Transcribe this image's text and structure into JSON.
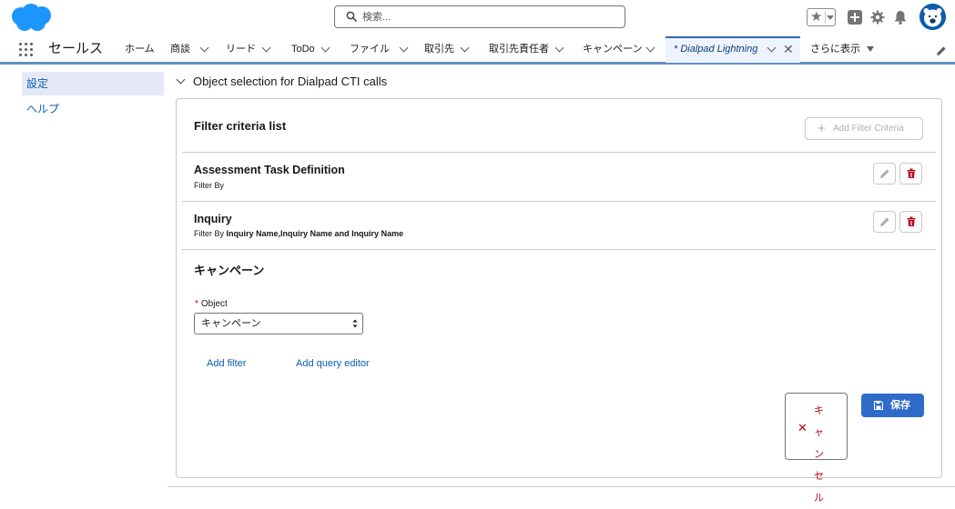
{
  "colors": {
    "brand": "#1b96ff",
    "link": "#0b5cab",
    "nav_underline": "#2f69b3",
    "save_button": "#2f6bc9",
    "cancel_text": "#ba0517",
    "delete_icon": "#ba0517"
  },
  "header": {
    "logo_icon": "salesforce-cloud-logo",
    "search": {
      "placeholder": "検索...",
      "value": ""
    },
    "icons": [
      "favorites-star-icon",
      "global-add-icon",
      "setup-gear-icon",
      "notification-bell-icon",
      "user-avatar"
    ]
  },
  "nav": {
    "app_name": "セールス",
    "tabs": [
      {
        "label": "ホーム",
        "has_menu": false
      },
      {
        "label": "商談",
        "has_menu": true
      },
      {
        "label": "リード",
        "has_menu": true
      },
      {
        "label": "ToDo",
        "has_menu": true
      },
      {
        "label": "ファイル",
        "has_menu": true
      },
      {
        "label": "取引先",
        "has_menu": true
      },
      {
        "label": "取引先責任者",
        "has_menu": true
      },
      {
        "label": "キャンペーン",
        "has_menu": true
      },
      {
        "label": "* Dialpad Lightning",
        "has_menu": true,
        "active": true,
        "closable": true
      }
    ],
    "more_label": "さらに表示"
  },
  "sidebar": {
    "items": [
      {
        "label": "設定",
        "active": true
      },
      {
        "label": "ヘルプ",
        "active": false
      }
    ]
  },
  "main": {
    "section_title": "Object selection for Dialpad CTI calls",
    "filter_list_title": "Filter criteria list",
    "add_filter_criteria_label": "Add Filter Criteria",
    "records": [
      {
        "title": "Assessment Task Definition",
        "filter_prefix": "Filter By",
        "filter_value": ""
      },
      {
        "title": "Inquiry",
        "filter_prefix": "Filter By",
        "filter_value": "Inquiry Name,Inquiry Name and Inquiry Name"
      }
    ],
    "edit_form": {
      "title": "キャンペーン",
      "object_label": "Object",
      "object_value": "キャンペーン",
      "add_filter_label": "Add filter",
      "add_query_editor_label": "Add query editor",
      "cancel_label": "キャンセル",
      "save_label": "保存"
    }
  }
}
